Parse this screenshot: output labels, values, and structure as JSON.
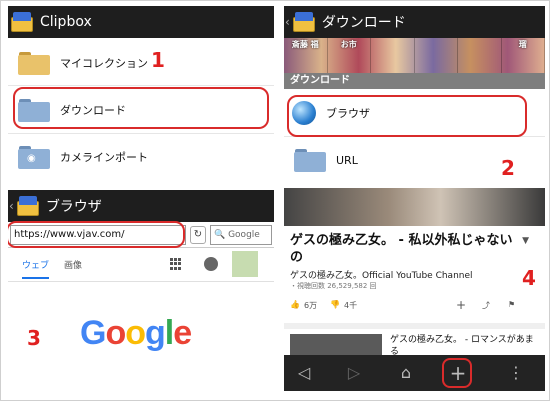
{
  "panel1": {
    "title": "Clipbox",
    "items": [
      {
        "label": "マイコレクション"
      },
      {
        "label": "ダウンロード"
      },
      {
        "label": "カメラインポート"
      }
    ],
    "step": "1"
  },
  "panel2": {
    "title": "ダウンロード",
    "banner": [
      "斎藤 福",
      "お市",
      "",
      "",
      "",
      "瑠"
    ],
    "section": "ダウンロード",
    "items": [
      {
        "label": "ブラウザ"
      },
      {
        "label": "URL"
      }
    ],
    "step": "2"
  },
  "panel3": {
    "title": "ブラウザ",
    "url": "https://www.vjav.com/",
    "search_placeholder": "Google",
    "tabs": [
      "ウェブ",
      "画像"
    ],
    "logo": "Google",
    "step": "3"
  },
  "panel4": {
    "video_title": "ゲスの極み乙女。 - 私以外私じゃないの",
    "channel": "ゲスの極み乙女。Official YouTube Channel",
    "views": "・視聴回数 26,529,582 回",
    "likes": "6万",
    "dislikes": "4千",
    "next_title": "ゲスの極み乙女。 - ロマンスがあまる",
    "step": "4"
  },
  "colors": {
    "annotation": "#d92b2b",
    "topbar": "#1e1e1e",
    "section": "#7e7e7e",
    "link_blue": "#1a73e8"
  }
}
